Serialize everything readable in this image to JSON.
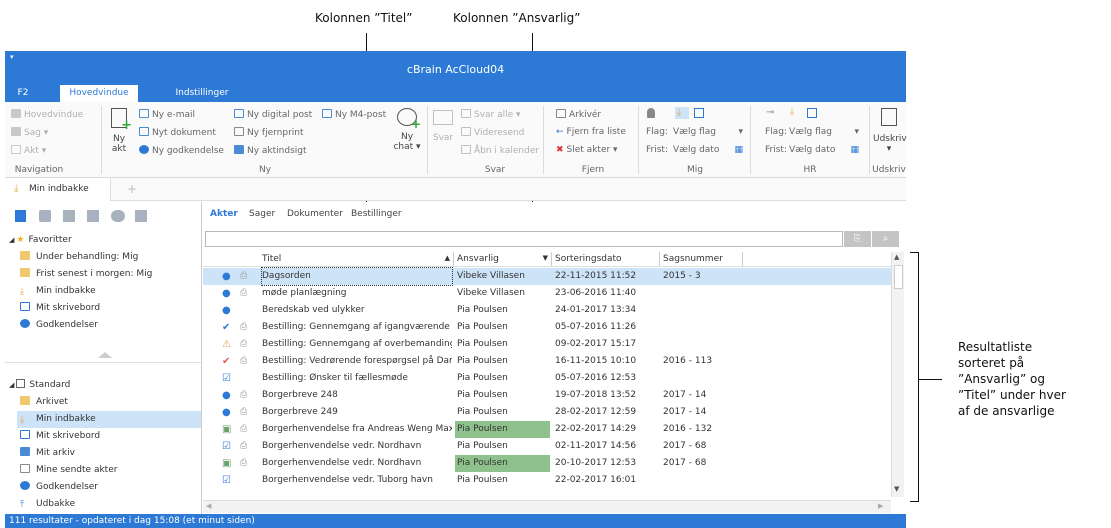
{
  "annotations": {
    "titel": "Kolonnen ”Titel”",
    "ansvarlig": "Kolonnen ”Ansvarlig”",
    "result_lines": [
      "Resultatliste",
      "sorteret på",
      "”Ansvarlig” og",
      "”Titel” under hver",
      "af de ansvarlige"
    ]
  },
  "window": {
    "title": "cBrain AcCloud04"
  },
  "menu": {
    "tabs": [
      "F2",
      "Hovedvindue",
      "Indstillinger"
    ]
  },
  "ribbon": {
    "nav": {
      "items": [
        "Hovedvindue",
        "Sag ▾",
        "Akt ▾"
      ],
      "group": "Navigation"
    },
    "ny": {
      "big": "Ny",
      "big2": "akt",
      "items": [
        "Ny e-mail",
        "Nyt dokument",
        "Ny godkendelse",
        "Ny digital post",
        "Ny fjernprint",
        "Ny aktindsigt",
        "Ny M4-post"
      ],
      "chat": "Ny",
      "chat2": "chat ▾",
      "group": "Ny"
    },
    "svar": {
      "big": "Svar",
      "items": [
        "Svar alle ▾",
        "Videresend",
        "Åbn i kalender"
      ],
      "group": "Svar"
    },
    "fjern": {
      "items": [
        "Arkívér",
        "Fjern fra liste",
        "Slet akter ▾"
      ],
      "group": "Fjern"
    },
    "mig": {
      "flag_label": "Flag:",
      "flag_value": "Vælg flag",
      "frist_label": "Frist:",
      "frist_value": "Vælg dato",
      "group": "Mig"
    },
    "hr": {
      "flag_label": "Flag:",
      "flag_value": "Vælg flag",
      "frist_label": "Frist:",
      "frist_value": "Vælg dato",
      "group": "HR"
    },
    "udskriv": {
      "big": "Udskriv",
      "group": "Udskriv"
    }
  },
  "tabs": {
    "active": "Min indbakke",
    "add": "+"
  },
  "tree": {
    "favorites_header": "Favoritter",
    "favorites": [
      "Under behandling: Mig",
      "Frist senest i morgen: Mig",
      "Min indbakke",
      "Mit skrivebord",
      "Godkendelser"
    ],
    "standard_header": "Standard",
    "standard": [
      "Arkivet",
      "Min indbakke",
      "Mit skrivebord",
      "Mit arkiv",
      "Mine sendte akter",
      "Godkendelser",
      "Udbakke"
    ]
  },
  "subtabs": [
    "Akter",
    "Sager",
    "Dokumenter",
    "Bestillinger"
  ],
  "grid": {
    "columns": [
      "Titel",
      "Ansvarlig",
      "Sorteringsdato",
      "Sagsnummer"
    ],
    "rows": [
      {
        "titel": "Dagsorden",
        "ansvarlig": "Vibeke Villasen",
        "dato": "22-11-2015 11:52",
        "sag": "2015 - 3"
      },
      {
        "titel": "møde planlægning",
        "ansvarlig": "Vibeke Villasen",
        "dato": "23-06-2016 11:40",
        "sag": ""
      },
      {
        "titel": "Beredskab ved ulykker",
        "ansvarlig": "Pia Poulsen",
        "dato": "24-01-2017 13:34",
        "sag": ""
      },
      {
        "titel": "Bestilling: Gennemgang af igangværende s...",
        "ansvarlig": "Pia Poulsen",
        "dato": "05-07-2016 11:26",
        "sag": ""
      },
      {
        "titel": "Bestilling: Gennemgang af overbemandings...",
        "ansvarlig": "Pia Poulsen",
        "dato": "09-02-2017 15:17",
        "sag": ""
      },
      {
        "titel": "Bestilling: Vedrørende forespørgsel på Dam...",
        "ansvarlig": "Pia Poulsen",
        "dato": "16-11-2015 10:10",
        "sag": "2016 - 113"
      },
      {
        "titel": "Bestilling: Ønsker til fællesmøde",
        "ansvarlig": "Pia Poulsen",
        "dato": "05-07-2016 12:53",
        "sag": ""
      },
      {
        "titel": "Borgerbreve 248",
        "ansvarlig": "Pia Poulsen",
        "dato": "19-07-2018 13:52",
        "sag": "2017 - 14"
      },
      {
        "titel": "Borgerbreve 249",
        "ansvarlig": "Pia Poulsen",
        "dato": "28-02-2017 12:59",
        "sag": "2017 - 14"
      },
      {
        "titel": "Borgerhenvendelse fra Andreas Weng Maxsø",
        "ansvarlig": "Pia Poulsen",
        "dato": "22-02-2017 14:29",
        "sag": "2016 - 132"
      },
      {
        "titel": "Borgerhenvendelse vedr. Nordhavn",
        "ansvarlig": "Pia Poulsen",
        "dato": "02-11-2017 14:56",
        "sag": "2017 - 68"
      },
      {
        "titel": "Borgerhenvendelse vedr. Nordhavn",
        "ansvarlig": "Pia Poulsen",
        "dato": "20-10-2017 12:53",
        "sag": "2017 - 68"
      },
      {
        "titel": "Borgerhenvendelse vedr. Tuborg havn",
        "ansvarlig": "Pia Poulsen",
        "dato": "22-02-2017 16:01",
        "sag": ""
      }
    ]
  },
  "status": "111 resultater - opdateret i dag 15:08 (et minut siden)",
  "colors": {
    "accent": "#2d7ad6",
    "selection": "#cde3f7",
    "highlight": "#8fc18c"
  }
}
